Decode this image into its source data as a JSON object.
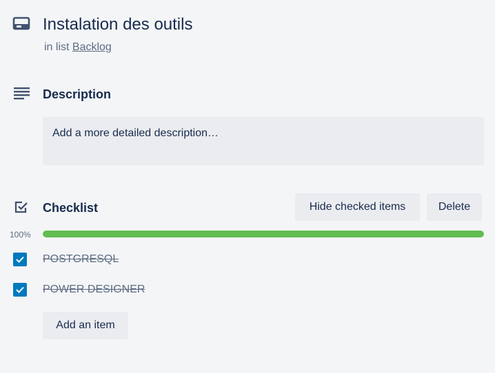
{
  "card": {
    "title": "Instalation des outils",
    "in_list_prefix": "in list",
    "list_name": "Backlog",
    "icon": "card-icon"
  },
  "description": {
    "title": "Description",
    "placeholder": "Add a more detailed description…",
    "icon": "description-lines-icon"
  },
  "checklist": {
    "title": "Checklist",
    "icon": "checkbox-icon",
    "hide_checked_label": "Hide checked items",
    "delete_label": "Delete",
    "progress_label": "100%",
    "progress_fraction": 1.0,
    "items": [
      {
        "text": "POSTGRESQL",
        "checked": true
      },
      {
        "text": "POWER DESIGNER",
        "checked": true
      }
    ],
    "add_item_label": "Add an item"
  },
  "colors": {
    "background": "#f4f5f7",
    "text": "#172b4d",
    "muted_text": "#5e6c84",
    "button_bg": "#ebecf0",
    "progress_fill": "#61bd4f",
    "checkbox_checked": "#0079bf"
  }
}
